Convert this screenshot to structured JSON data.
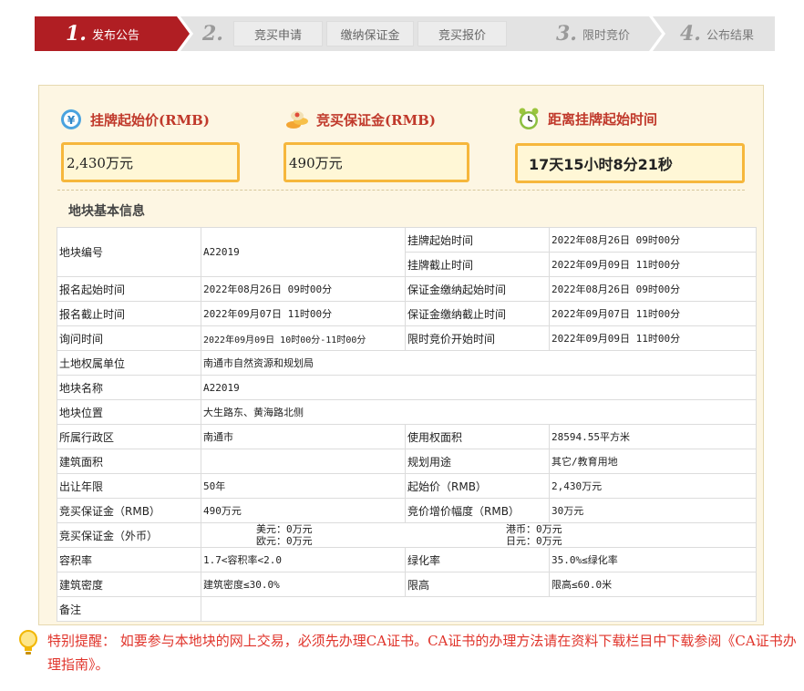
{
  "steps": [
    {
      "num": "1.",
      "label": "发布公告"
    },
    {
      "num": "2.",
      "label": ""
    },
    {
      "num": "3.",
      "label": "限时竞价"
    },
    {
      "num": "4.",
      "label": "公布结果"
    }
  ],
  "sub_steps": [
    "竞买申请",
    "缴纳保证金",
    "竞买报价"
  ],
  "colors": {
    "active_step": "#b01e23",
    "inactive_step": "#e3e3e3",
    "stat_border": "#f6b73c",
    "reminder": "#e0342b"
  },
  "stats": {
    "start_price": {
      "title": "挂牌起始价(RMB)",
      "value": "2,430万元",
      "icon": "money-icon"
    },
    "deposit": {
      "title": "竞买保证金(RMB)",
      "value": "490万元",
      "icon": "gold-coins-icon"
    },
    "countdown": {
      "title": "距离挂牌起始时间",
      "value": "17天15小时8分21秒",
      "icon": "alarm-clock-icon"
    }
  },
  "section_title": "地块基本信息",
  "table": {
    "plot_no_label": "地块编号",
    "plot_no": "A22019",
    "listing_start_label": "挂牌起始时间",
    "listing_start": "2022年08月26日 09时00分",
    "listing_end_label": "挂牌截止时间",
    "listing_end": "2022年09月09日 11时00分",
    "reg_start_label": "报名起始时间",
    "reg_start": "2022年08月26日 09时00分",
    "deposit_start_label": "保证金缴纳起始时间",
    "deposit_start": "2022年08月26日 09时00分",
    "reg_end_label": "报名截止时间",
    "reg_end": "2022年09月07日 11时00分",
    "deposit_end_label": "保证金缴纳截止时间",
    "deposit_end": "2022年09月07日 11时00分",
    "inquiry_label": "询问时间",
    "inquiry": "2022年09月09日 10时00分-11时00分",
    "bid_start_label": "限时竞价开始时间",
    "bid_start": "2022年09月09日 11时00分",
    "owner_label": "土地权属单位",
    "owner": "南通市自然资源和规划局",
    "plot_name_label": "地块名称",
    "plot_name": "A22019",
    "location_label": "地块位置",
    "location": "大生路东、黄海路北侧",
    "district_label": "所属行政区",
    "district": "南通市",
    "use_area_label": "使用权面积",
    "use_area": "28594.55平方米",
    "build_area_label": "建筑面积",
    "build_area": "",
    "planned_use_label": "规划用途",
    "planned_use": "其它/教育用地",
    "term_label": "出让年限",
    "term": "50年",
    "start_price_label": "起始价（RMB）",
    "start_price": "2,430万元",
    "deposit_label": "竞买保证金（RMB）",
    "deposit": "490万元",
    "increment_label": "竞价增价幅度（RMB）",
    "increment": "30万元",
    "fx_deposit_label": "竞买保证金（外币）",
    "fx_usd": "美元：0万元",
    "fx_hkd": "港币：0万元",
    "fx_eur": "欧元：0万元",
    "fx_jpy": "日元：0万元",
    "far_label": "容积率",
    "far": "1.7<容积率<2.0",
    "green_label": "绿化率",
    "green": "35.0%≤绿化率",
    "density_label": "建筑密度",
    "density": "建筑密度≤30.0%",
    "height_label": "限高",
    "height": "限高≤60.0米",
    "remark_label": "备注",
    "remark": ""
  },
  "reminder": {
    "icon": "lightbulb-icon",
    "text": "特别提醒：  如要参与本地块的网上交易，必须先办理CA证书。CA证书的办理方法请在资料下载栏目中下载参阅《CA证书办理指南》。"
  }
}
